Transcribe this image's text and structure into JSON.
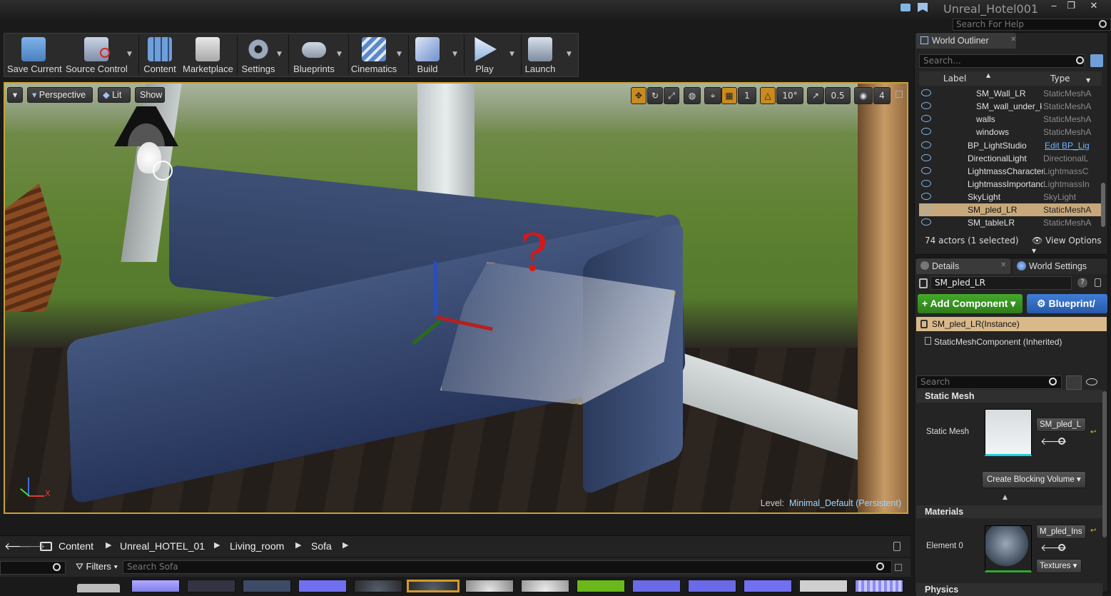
{
  "title_bar": {
    "project_name": "Unreal_Hotel001",
    "help_search_placeholder": "Search For Help",
    "minimize": "‒",
    "maximize": "❐",
    "close": "✕"
  },
  "toolbar": {
    "buttons": [
      {
        "label": "Save Current",
        "icon": "save-icon"
      },
      {
        "label": "Source Control",
        "icon": "source-control-icon"
      },
      {
        "label": "Content",
        "icon": "content-grid-icon"
      },
      {
        "label": "Marketplace",
        "icon": "marketplace-bag-icon"
      },
      {
        "label": "Settings",
        "icon": "gear-icon"
      },
      {
        "label": "Blueprints",
        "icon": "gamepad-icon"
      },
      {
        "label": "Cinematics",
        "icon": "clapper-icon"
      },
      {
        "label": "Build",
        "icon": "build-cubes-icon"
      },
      {
        "label": "Play",
        "icon": "play-icon"
      },
      {
        "label": "Launch",
        "icon": "launch-monitor-icon"
      }
    ]
  },
  "viewport": {
    "view_mode": "Perspective",
    "lighting": "Lit",
    "show": "Show",
    "grid_snap": "1",
    "rotation_snap": "10°",
    "scale_snap": "0.5",
    "camera_speed": "4",
    "level_label": "Level:",
    "level_name": "Minimal_Default (Persistent)",
    "axis_x": "X",
    "annotation": "?"
  },
  "outliner": {
    "tab": "World Outliner",
    "search_placeholder": "Search...",
    "col_label": "Label",
    "col_type": "Type",
    "rows": [
      {
        "name": "SM_Wall_LR",
        "type": "StaticMeshA"
      },
      {
        "name": "SM_wall_under_kitc",
        "type": "StaticMeshA"
      },
      {
        "name": "walls",
        "type": "StaticMeshA"
      },
      {
        "name": "windows",
        "type": "StaticMeshA"
      },
      {
        "name": "BP_LightStudio",
        "type": "Edit BP_Lig"
      },
      {
        "name": "DirectionalLight",
        "type": "DirectionalL"
      },
      {
        "name": "LightmassCharacterI",
        "type": "LightmassC"
      },
      {
        "name": "LightmassImportanc",
        "type": "LightmassIn"
      },
      {
        "name": "SkyLight",
        "type": "SkyLight"
      },
      {
        "name": "SM_pled_LR",
        "type": "StaticMeshA"
      },
      {
        "name": "SM_tableLR",
        "type": "StaticMeshA"
      }
    ],
    "actor_count": "74 actors (1 selected)",
    "view_options": "View Options"
  },
  "details": {
    "tab_details": "Details",
    "tab_world_settings": "World Settings",
    "actor_name": "SM_pled_LR",
    "add_component": "Add Component",
    "blueprint": "Blueprint/",
    "instance": "SM_pled_LR(Instance)",
    "component": "StaticMeshComponent (Inherited)",
    "search_placeholder": "Search",
    "section_static_mesh": "Static Mesh",
    "static_mesh_label": "Static Mesh",
    "static_mesh_value": "SM_pled_L",
    "create_blocking_volume": "Create Blocking Volume",
    "section_materials": "Materials",
    "element0_label": "Element 0",
    "element0_value": "M_pled_Ins",
    "textures": "Textures",
    "section_physics": "Physics"
  },
  "content_browser": {
    "path": [
      "Content",
      "Unreal_HOTEL_01",
      "Living_room",
      "Sofa"
    ],
    "filters": "Filters",
    "search_placeholder": "Search Sofa"
  }
}
